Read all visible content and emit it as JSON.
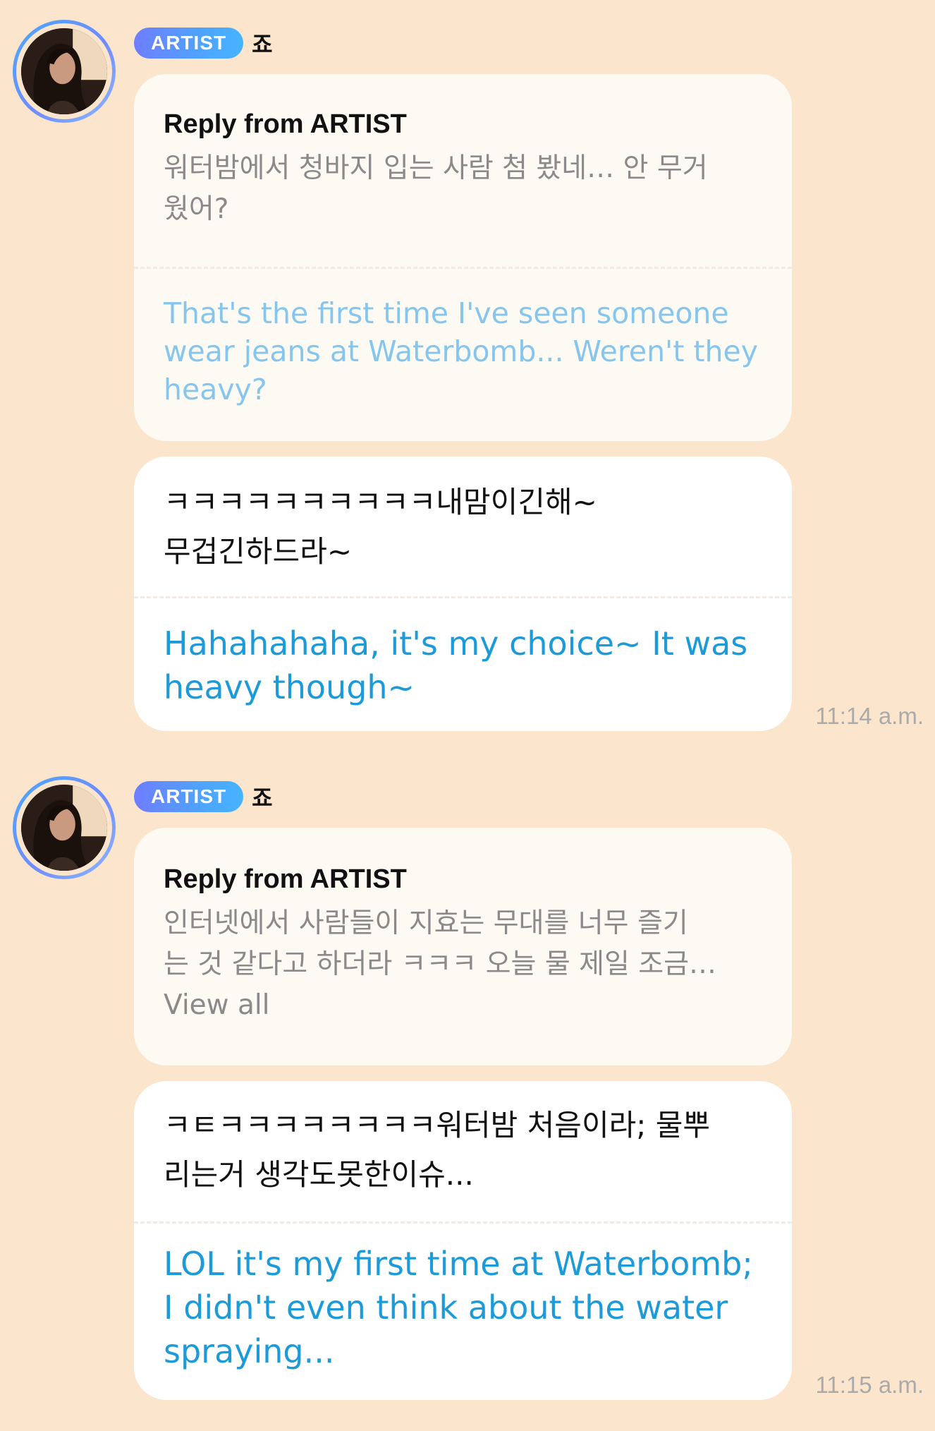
{
  "messages": [
    {
      "badge": "ARTIST",
      "name": "죠",
      "reply": {
        "title": "Reply from ARTIST",
        "korean_lines": [
          "워터밤에서 청바지 입는 사람 첨 봤네… 안 무거",
          "웠어?"
        ],
        "english_lines": [
          "That's the first time I've seen someone",
          "wear jeans at Waterbomb... Weren't they",
          "heavy?"
        ]
      },
      "body": {
        "korean_lines": [
          "ㅋㅋㅋㅋㅋㅋㅋㅋㅋㅋ내맘이긴해~",
          "무겁긴하드라~"
        ],
        "english_lines": [
          "Hahahahaha, it's my choice~ It was",
          "heavy though~"
        ]
      },
      "time": "11:14 a.m."
    },
    {
      "badge": "ARTIST",
      "name": "죠",
      "reply": {
        "title": "Reply from ARTIST",
        "korean_lines": [
          "인터넷에서 사람들이 지효는 무대를 너무 즐기",
          "는 것 같다고 하더라 ㅋㅋㅋ 오늘 물 제일 조금…"
        ],
        "view_all": "View all"
      },
      "body": {
        "korean_lines": [
          "ㅋㅌㅋㅋㅋㅋㅋㅋㅋㅋ워터밤 처음이라; 물뿌",
          "리는거 생각도못한이슈..."
        ],
        "english_lines": [
          "LOL it's my first time at Waterbomb;",
          "I didn't even think about the water",
          "spraying..."
        ]
      },
      "time": "11:15 a.m."
    }
  ]
}
